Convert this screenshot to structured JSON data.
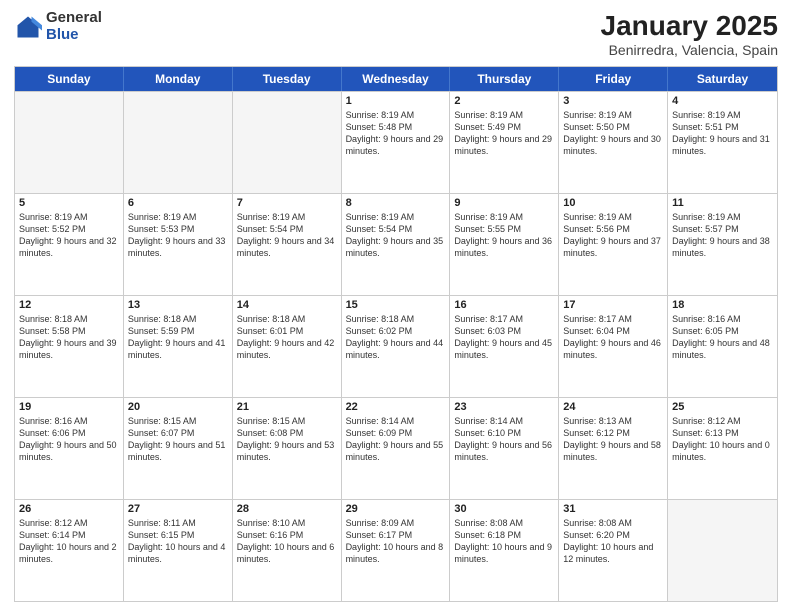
{
  "header": {
    "logo": {
      "general": "General",
      "blue": "Blue"
    },
    "title": "January 2025",
    "location": "Benirredra, Valencia, Spain"
  },
  "days_of_week": [
    "Sunday",
    "Monday",
    "Tuesday",
    "Wednesday",
    "Thursday",
    "Friday",
    "Saturday"
  ],
  "weeks": [
    [
      {
        "day": "",
        "empty": true
      },
      {
        "day": "",
        "empty": true
      },
      {
        "day": "",
        "empty": true
      },
      {
        "day": "1",
        "sunrise": "Sunrise: 8:19 AM",
        "sunset": "Sunset: 5:48 PM",
        "daylight": "Daylight: 9 hours and 29 minutes."
      },
      {
        "day": "2",
        "sunrise": "Sunrise: 8:19 AM",
        "sunset": "Sunset: 5:49 PM",
        "daylight": "Daylight: 9 hours and 29 minutes."
      },
      {
        "day": "3",
        "sunrise": "Sunrise: 8:19 AM",
        "sunset": "Sunset: 5:50 PM",
        "daylight": "Daylight: 9 hours and 30 minutes."
      },
      {
        "day": "4",
        "sunrise": "Sunrise: 8:19 AM",
        "sunset": "Sunset: 5:51 PM",
        "daylight": "Daylight: 9 hours and 31 minutes."
      }
    ],
    [
      {
        "day": "5",
        "sunrise": "Sunrise: 8:19 AM",
        "sunset": "Sunset: 5:52 PM",
        "daylight": "Daylight: 9 hours and 32 minutes."
      },
      {
        "day": "6",
        "sunrise": "Sunrise: 8:19 AM",
        "sunset": "Sunset: 5:53 PM",
        "daylight": "Daylight: 9 hours and 33 minutes."
      },
      {
        "day": "7",
        "sunrise": "Sunrise: 8:19 AM",
        "sunset": "Sunset: 5:54 PM",
        "daylight": "Daylight: 9 hours and 34 minutes."
      },
      {
        "day": "8",
        "sunrise": "Sunrise: 8:19 AM",
        "sunset": "Sunset: 5:54 PM",
        "daylight": "Daylight: 9 hours and 35 minutes."
      },
      {
        "day": "9",
        "sunrise": "Sunrise: 8:19 AM",
        "sunset": "Sunset: 5:55 PM",
        "daylight": "Daylight: 9 hours and 36 minutes."
      },
      {
        "day": "10",
        "sunrise": "Sunrise: 8:19 AM",
        "sunset": "Sunset: 5:56 PM",
        "daylight": "Daylight: 9 hours and 37 minutes."
      },
      {
        "day": "11",
        "sunrise": "Sunrise: 8:19 AM",
        "sunset": "Sunset: 5:57 PM",
        "daylight": "Daylight: 9 hours and 38 minutes."
      }
    ],
    [
      {
        "day": "12",
        "sunrise": "Sunrise: 8:18 AM",
        "sunset": "Sunset: 5:58 PM",
        "daylight": "Daylight: 9 hours and 39 minutes."
      },
      {
        "day": "13",
        "sunrise": "Sunrise: 8:18 AM",
        "sunset": "Sunset: 5:59 PM",
        "daylight": "Daylight: 9 hours and 41 minutes."
      },
      {
        "day": "14",
        "sunrise": "Sunrise: 8:18 AM",
        "sunset": "Sunset: 6:01 PM",
        "daylight": "Daylight: 9 hours and 42 minutes."
      },
      {
        "day": "15",
        "sunrise": "Sunrise: 8:18 AM",
        "sunset": "Sunset: 6:02 PM",
        "daylight": "Daylight: 9 hours and 44 minutes."
      },
      {
        "day": "16",
        "sunrise": "Sunrise: 8:17 AM",
        "sunset": "Sunset: 6:03 PM",
        "daylight": "Daylight: 9 hours and 45 minutes."
      },
      {
        "day": "17",
        "sunrise": "Sunrise: 8:17 AM",
        "sunset": "Sunset: 6:04 PM",
        "daylight": "Daylight: 9 hours and 46 minutes."
      },
      {
        "day": "18",
        "sunrise": "Sunrise: 8:16 AM",
        "sunset": "Sunset: 6:05 PM",
        "daylight": "Daylight: 9 hours and 48 minutes."
      }
    ],
    [
      {
        "day": "19",
        "sunrise": "Sunrise: 8:16 AM",
        "sunset": "Sunset: 6:06 PM",
        "daylight": "Daylight: 9 hours and 50 minutes."
      },
      {
        "day": "20",
        "sunrise": "Sunrise: 8:15 AM",
        "sunset": "Sunset: 6:07 PM",
        "daylight": "Daylight: 9 hours and 51 minutes."
      },
      {
        "day": "21",
        "sunrise": "Sunrise: 8:15 AM",
        "sunset": "Sunset: 6:08 PM",
        "daylight": "Daylight: 9 hours and 53 minutes."
      },
      {
        "day": "22",
        "sunrise": "Sunrise: 8:14 AM",
        "sunset": "Sunset: 6:09 PM",
        "daylight": "Daylight: 9 hours and 55 minutes."
      },
      {
        "day": "23",
        "sunrise": "Sunrise: 8:14 AM",
        "sunset": "Sunset: 6:10 PM",
        "daylight": "Daylight: 9 hours and 56 minutes."
      },
      {
        "day": "24",
        "sunrise": "Sunrise: 8:13 AM",
        "sunset": "Sunset: 6:12 PM",
        "daylight": "Daylight: 9 hours and 58 minutes."
      },
      {
        "day": "25",
        "sunrise": "Sunrise: 8:12 AM",
        "sunset": "Sunset: 6:13 PM",
        "daylight": "Daylight: 10 hours and 0 minutes."
      }
    ],
    [
      {
        "day": "26",
        "sunrise": "Sunrise: 8:12 AM",
        "sunset": "Sunset: 6:14 PM",
        "daylight": "Daylight: 10 hours and 2 minutes."
      },
      {
        "day": "27",
        "sunrise": "Sunrise: 8:11 AM",
        "sunset": "Sunset: 6:15 PM",
        "daylight": "Daylight: 10 hours and 4 minutes."
      },
      {
        "day": "28",
        "sunrise": "Sunrise: 8:10 AM",
        "sunset": "Sunset: 6:16 PM",
        "daylight": "Daylight: 10 hours and 6 minutes."
      },
      {
        "day": "29",
        "sunrise": "Sunrise: 8:09 AM",
        "sunset": "Sunset: 6:17 PM",
        "daylight": "Daylight: 10 hours and 8 minutes."
      },
      {
        "day": "30",
        "sunrise": "Sunrise: 8:08 AM",
        "sunset": "Sunset: 6:18 PM",
        "daylight": "Daylight: 10 hours and 9 minutes."
      },
      {
        "day": "31",
        "sunrise": "Sunrise: 8:08 AM",
        "sunset": "Sunset: 6:20 PM",
        "daylight": "Daylight: 10 hours and 12 minutes."
      },
      {
        "day": "",
        "empty": true
      }
    ]
  ]
}
